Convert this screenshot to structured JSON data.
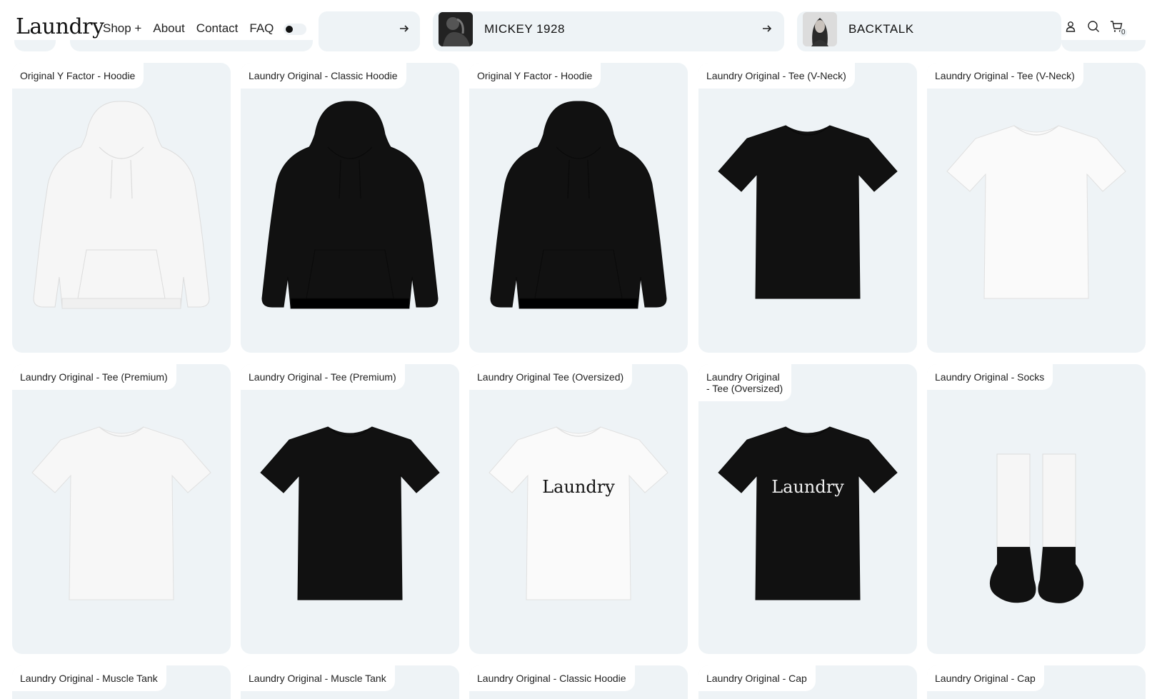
{
  "header": {
    "logo": "Laundry",
    "nav": [
      "Shop +",
      "About",
      "Contact",
      "FAQ"
    ],
    "pills": [
      {
        "title": ""
      },
      {
        "title": "MICKEY 1928"
      },
      {
        "title": "BACKTALK"
      }
    ],
    "cart_count": "0",
    "icons": [
      "user-icon",
      "search-icon",
      "cart-icon",
      "arrow-right-icon"
    ]
  },
  "products": [
    {
      "title": "Original Y Factor - Hoodie",
      "type": "hoodie",
      "color": "#f6f6f6",
      "print": "small"
    },
    {
      "title": "Laundry Original - Classic Hoodie",
      "type": "hoodie",
      "color": "#111111",
      "print": "small"
    },
    {
      "title": "Original Y Factor - Hoodie",
      "type": "hoodie",
      "color": "#111111",
      "print": "small"
    },
    {
      "title": "Laundry Original - Tee (V-Neck)",
      "type": "tee",
      "color": "#111111",
      "print": "small"
    },
    {
      "title": "Laundry Original - Tee (V-Neck)",
      "type": "tee",
      "color": "#fafafa",
      "print": "small"
    },
    {
      "title": "Laundry Original - Tee (Premium)",
      "type": "tee",
      "color": "#f7f7f7",
      "print": "small"
    },
    {
      "title": "Laundry Original - Tee (Premium)",
      "type": "tee",
      "color": "#111111",
      "print": "small"
    },
    {
      "title": "Laundry Original Tee (Oversized)",
      "type": "tee",
      "color": "#fafafa",
      "print": "large",
      "print_text": "Laundry"
    },
    {
      "title_lines": [
        "Laundry Original",
        "- Tee (Oversized)"
      ],
      "type": "tee",
      "color": "#111111",
      "print": "large",
      "print_text": "Laundry"
    },
    {
      "title": "Laundry Original - Socks",
      "type": "socks",
      "color": "#111111",
      "print": "small"
    },
    {
      "title": "Laundry Original - Muscle Tank",
      "type": "none"
    },
    {
      "title": "Laundry Original - Muscle Tank",
      "type": "none"
    },
    {
      "title": "Laundry Original - Classic Hoodie",
      "type": "none"
    },
    {
      "title": "Laundry Original - Cap",
      "type": "none"
    },
    {
      "title": "Laundry Original - Cap",
      "type": "none"
    }
  ],
  "colors": {
    "card_bg": "#eef3f6",
    "text": "#222222",
    "accent": "#111111"
  }
}
